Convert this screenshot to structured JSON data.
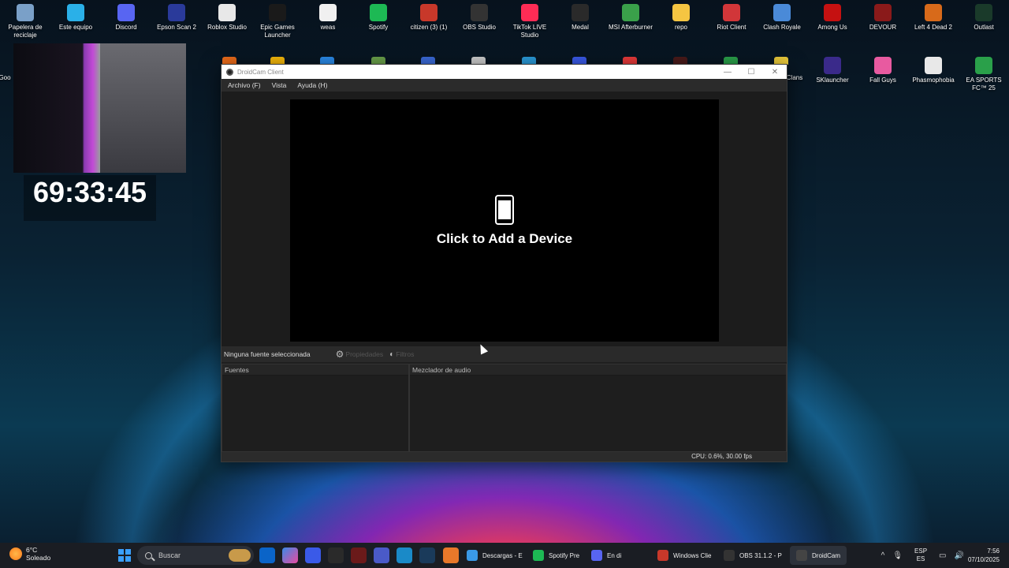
{
  "desktop": {
    "icons": [
      {
        "label": "Papelera de reciclaje",
        "color": "#7aa0c8"
      },
      {
        "label": "Este equipo",
        "color": "#2ab0e8"
      },
      {
        "label": "Discord",
        "color": "#5865f2"
      },
      {
        "label": "Epson Scan 2",
        "color": "#2a3a9a"
      },
      {
        "label": "Roblox Studio",
        "color": "#e8e8e8"
      },
      {
        "label": "Epic Games Launcher",
        "color": "#1a1a1a"
      },
      {
        "label": "weas",
        "color": "#f0f0f0"
      },
      {
        "label": "Spotify",
        "color": "#1db954"
      },
      {
        "label": "citizen (3) (1)",
        "color": "#c8382a"
      },
      {
        "label": "OBS Studio",
        "color": "#333333"
      },
      {
        "label": "TikTok LIVE Studio",
        "color": "#fe2c55"
      },
      {
        "label": "Medal",
        "color": "#2a2a2a"
      },
      {
        "label": "MSI Afterburner",
        "color": "#3aa04a"
      },
      {
        "label": "repo",
        "color": "#f5c542"
      },
      {
        "label": "Riot Client",
        "color": "#d13639"
      },
      {
        "label": "Clash Royale",
        "color": "#4a8ad8"
      },
      {
        "label": "Among Us",
        "color": "#c51111"
      },
      {
        "label": "DEVOUR",
        "color": "#8a1a1a"
      },
      {
        "label": "Left 4 Dead 2",
        "color": "#d86a1a"
      },
      {
        "label": "Outlast",
        "color": "#1a3a2a"
      }
    ],
    "row2_icons": [
      {
        "label": "Clans",
        "color": "#6a3aa0"
      },
      {
        "label": "SKlauncher",
        "color": "#3a2a8a"
      },
      {
        "label": "Fall Guys",
        "color": "#e85aa0"
      },
      {
        "label": "Phasmophobia",
        "color": "#e8e8e8"
      },
      {
        "label": "EA SPORTS FC™ 25",
        "color": "#2aa04a"
      }
    ],
    "left_cut_label": "Goo",
    "timer": "69:33:45"
  },
  "window": {
    "title": "DroidCam Client",
    "menu": [
      "Archivo (F)",
      "Vista",
      "Ayuda (H)"
    ],
    "preview_cta": "Click to Add a Device",
    "source_status": "Ninguna fuente seleccionada",
    "properties_label": "Propiedades",
    "filters_label": "Filtros",
    "sources_header": "Fuentes",
    "mixer_header": "Mezclador de audio",
    "status": "CPU: 0.6%, 30.00 fps"
  },
  "taskbar": {
    "weather_temp": "6°C",
    "weather_desc": "Soleado",
    "search_placeholder": "Buscar",
    "tasks": [
      {
        "label": "Descargas - E",
        "color": "#3a9ae8"
      },
      {
        "label": "Spotify Pre",
        "color": "#1db954"
      },
      {
        "label": "En di",
        "color": "#5865f2"
      },
      {
        "label": "Windows Clie",
        "color": "#c8382a"
      },
      {
        "label": "OBS 31.1.2 - P",
        "color": "#333333"
      },
      {
        "label": "DroidCam",
        "color": "#444444"
      }
    ],
    "lang_top": "ESP",
    "lang_bottom": "ES",
    "time": "7:56",
    "date": "07/10/2025"
  }
}
